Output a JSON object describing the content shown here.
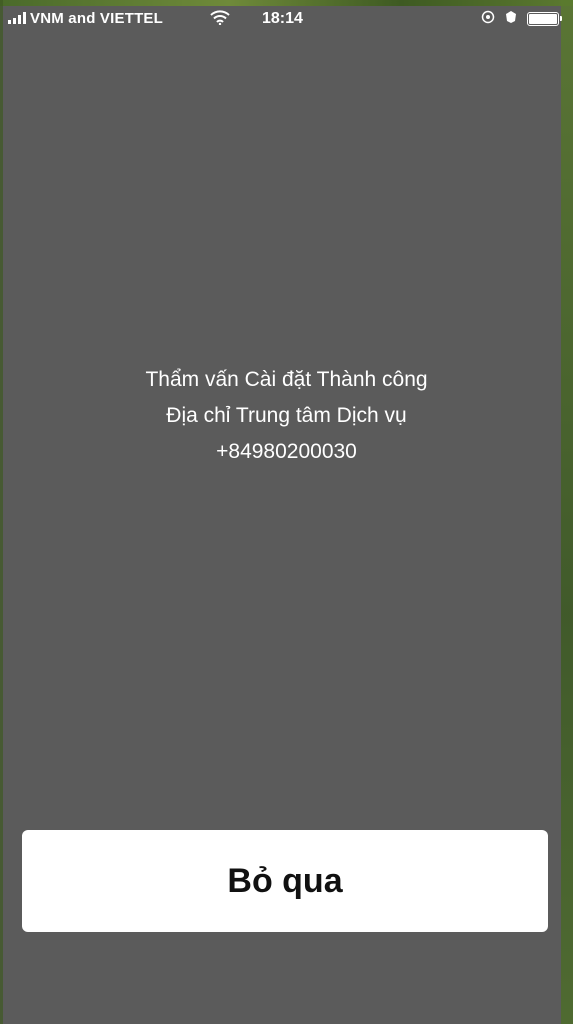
{
  "status_bar": {
    "carrier": "VNM and VIETTEL",
    "time": "18:14",
    "icons": [
      "signal-icon",
      "wifi-icon",
      "location-icon",
      "alarm-icon",
      "battery-icon"
    ]
  },
  "dialog": {
    "line1": "Thẩm vấn Cài đặt Thành công",
    "line2": "Địa chỉ Trung tâm Dịch vụ",
    "line3": "+84980200030"
  },
  "buttons": {
    "skip_label": "Bỏ qua"
  },
  "colors": {
    "background": "#5b5b5b",
    "text": "#ffffff",
    "button_bg": "#ffffff",
    "button_text": "#111111"
  }
}
